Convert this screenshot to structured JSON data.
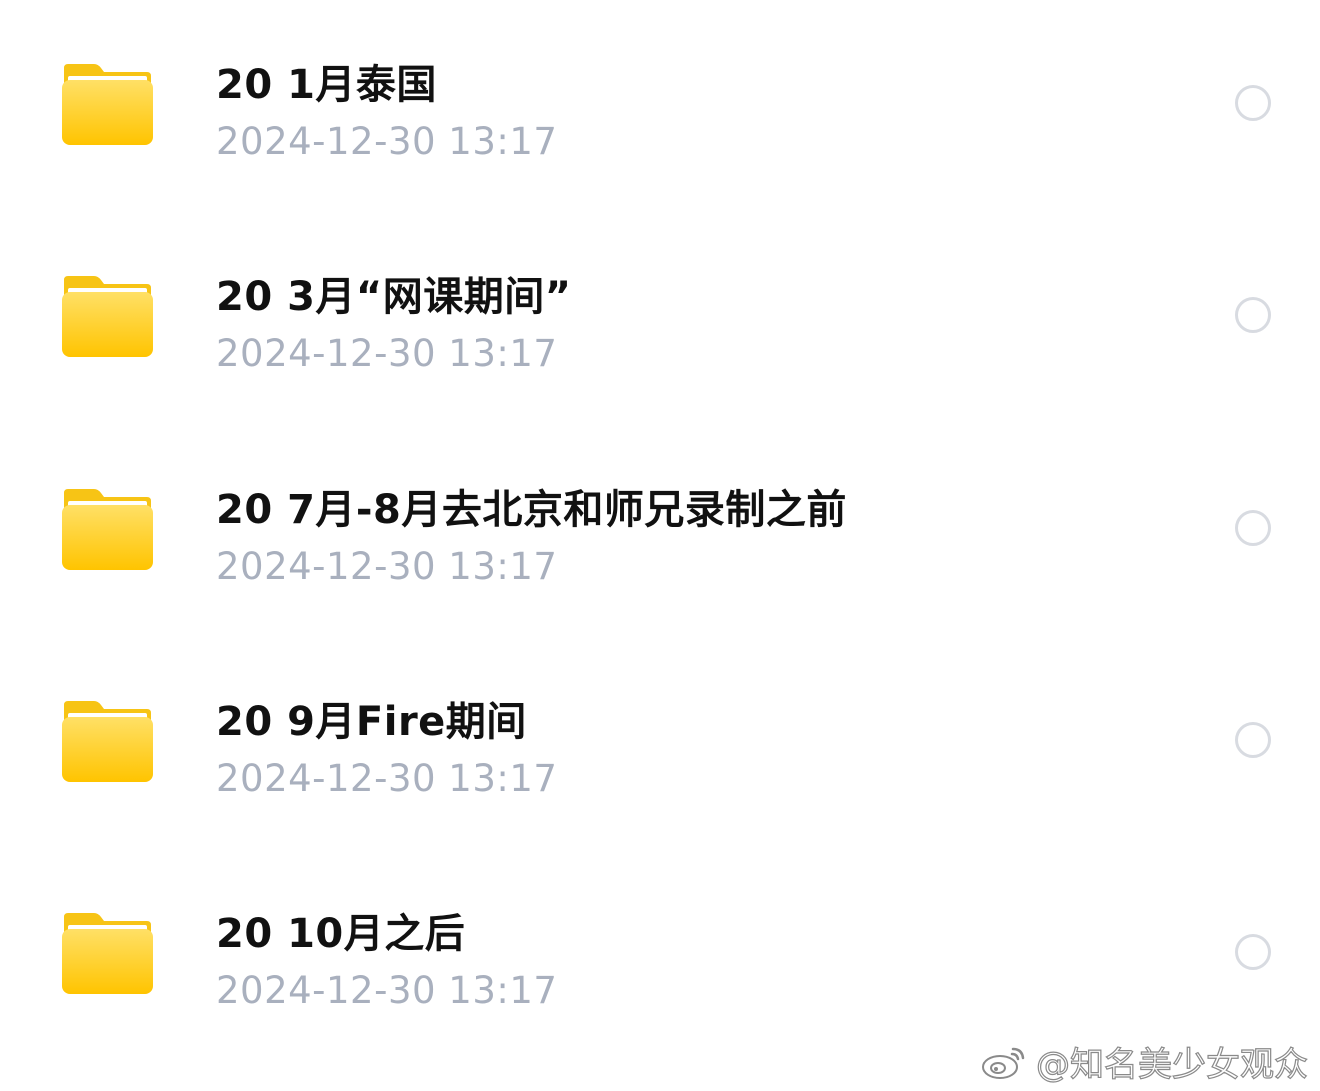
{
  "files": [
    {
      "icon": "folder-icon",
      "title": "20 1月泰国",
      "date": "2024-12-30 13:17",
      "selected": false
    },
    {
      "icon": "folder-icon",
      "title": "20 3月“网课期间”",
      "date": "2024-12-30 13:17",
      "selected": false
    },
    {
      "icon": "folder-icon",
      "title": "20 7月-8月去北京和师兄录制之前",
      "date": "2024-12-30 13:17",
      "selected": false
    },
    {
      "icon": "folder-icon",
      "title": "20 9月Fire期间",
      "date": "2024-12-30 13:17",
      "selected": false
    },
    {
      "icon": "folder-icon",
      "title": "20 10月之后",
      "date": "2024-12-30 13:17",
      "selected": false
    }
  ],
  "watermark": {
    "icon": "weibo-icon",
    "text": "@知名美少女观众"
  },
  "colors": {
    "folder_top": "#ffd84a",
    "folder_bottom": "#ffc600",
    "date_text": "#a9b0be",
    "title_text": "#111111",
    "radio_border": "#d8dbe1"
  }
}
